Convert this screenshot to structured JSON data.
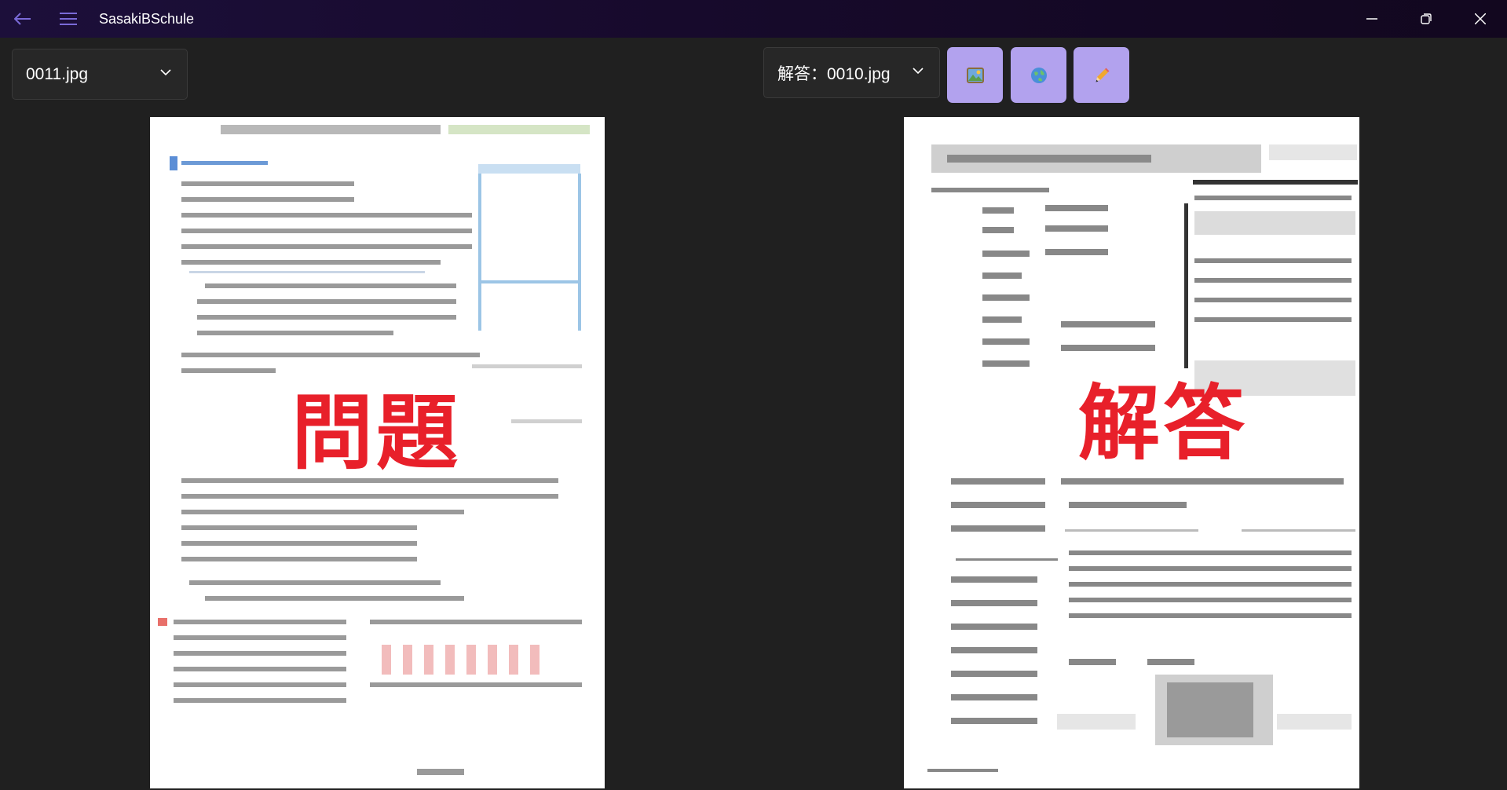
{
  "titlebar": {
    "app_title": "SasakiBSchule",
    "back_icon": "back-arrow-icon",
    "menu_icon": "hamburger-menu-icon"
  },
  "window_controls": {
    "minimize_icon": "minimize-icon",
    "maximize_icon": "restore-icon",
    "close_icon": "close-icon"
  },
  "left_panel": {
    "selected_file": "0011.jpg",
    "label": "問題"
  },
  "right_panel": {
    "selected_file": "解答：0010.jpg",
    "label": "解答"
  },
  "actions": [
    {
      "icon": "picture-icon",
      "glyph": "🖼"
    },
    {
      "icon": "globe-icon",
      "glyph": "🌐"
    },
    {
      "icon": "pencil-icon",
      "glyph": "✏"
    }
  ],
  "colors": {
    "accent": "#b2a2ee",
    "label_red": "#e8202a",
    "titlebar": "#1c0f3a",
    "background": "#202020"
  }
}
